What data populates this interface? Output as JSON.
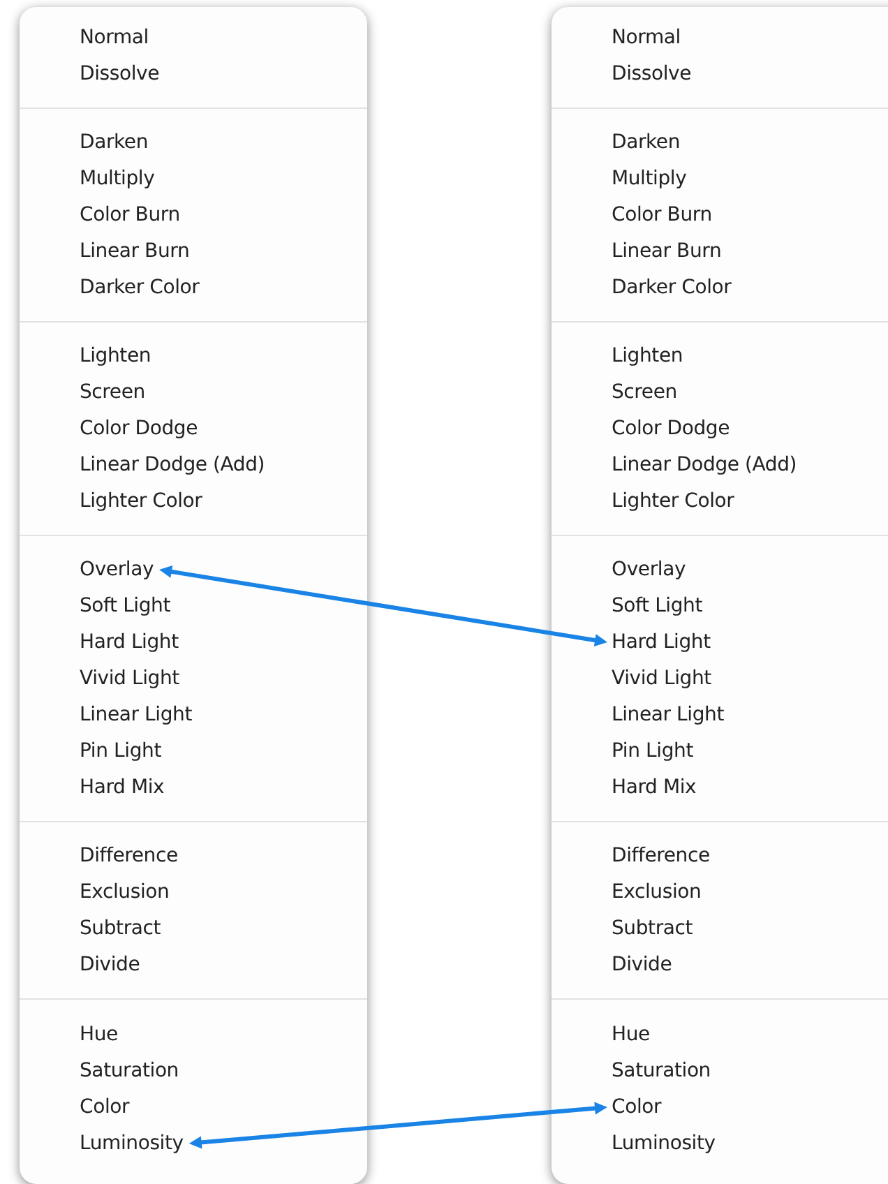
{
  "menus": [
    {
      "groups": [
        {
          "items": [
            {
              "label": "Normal"
            },
            {
              "label": "Dissolve"
            }
          ]
        },
        {
          "items": [
            {
              "label": "Darken"
            },
            {
              "label": "Multiply"
            },
            {
              "label": "Color Burn"
            },
            {
              "label": "Linear Burn"
            },
            {
              "label": "Darker Color"
            }
          ]
        },
        {
          "items": [
            {
              "label": "Lighten"
            },
            {
              "label": "Screen"
            },
            {
              "label": "Color Dodge"
            },
            {
              "label": "Linear Dodge (Add)"
            },
            {
              "label": "Lighter Color"
            }
          ]
        },
        {
          "items": [
            {
              "label": "Overlay",
              "arrow_end": true
            },
            {
              "label": "Soft Light"
            },
            {
              "label": "Hard Light"
            },
            {
              "label": "Vivid Light"
            },
            {
              "label": "Linear Light"
            },
            {
              "label": "Pin Light"
            },
            {
              "label": "Hard Mix"
            }
          ]
        },
        {
          "items": [
            {
              "label": "Difference"
            },
            {
              "label": "Exclusion"
            },
            {
              "label": "Subtract"
            },
            {
              "label": "Divide"
            }
          ]
        },
        {
          "items": [
            {
              "label": "Hue"
            },
            {
              "label": "Saturation"
            },
            {
              "label": "Color"
            },
            {
              "label": "Luminosity",
              "arrow_end": true
            }
          ]
        }
      ]
    },
    {
      "groups": [
        {
          "items": [
            {
              "label": "Normal"
            },
            {
              "label": "Dissolve"
            }
          ]
        },
        {
          "items": [
            {
              "label": "Darken"
            },
            {
              "label": "Multiply"
            },
            {
              "label": "Color Burn"
            },
            {
              "label": "Linear Burn"
            },
            {
              "label": "Darker Color"
            }
          ]
        },
        {
          "items": [
            {
              "label": "Lighten"
            },
            {
              "label": "Screen"
            },
            {
              "label": "Color Dodge"
            },
            {
              "label": "Linear Dodge (Add)"
            },
            {
              "label": "Lighter Color"
            }
          ]
        },
        {
          "items": [
            {
              "label": "Overlay"
            },
            {
              "label": "Soft Light"
            },
            {
              "label": "Hard Light",
              "arrow_end": true
            },
            {
              "label": "Vivid Light"
            },
            {
              "label": "Linear Light"
            },
            {
              "label": "Pin Light"
            },
            {
              "label": "Hard Mix"
            }
          ]
        },
        {
          "items": [
            {
              "label": "Difference"
            },
            {
              "label": "Exclusion"
            },
            {
              "label": "Subtract"
            },
            {
              "label": "Divide"
            }
          ]
        },
        {
          "items": [
            {
              "label": "Hue"
            },
            {
              "label": "Saturation"
            },
            {
              "label": "Color",
              "arrow_end": true
            },
            {
              "label": "Luminosity"
            }
          ]
        }
      ]
    }
  ]
}
